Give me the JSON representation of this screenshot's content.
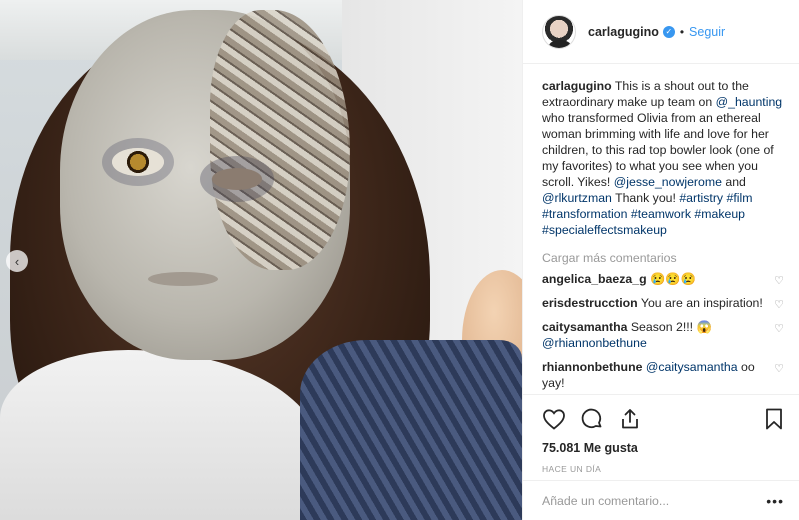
{
  "post": {
    "username": "carlagugino",
    "follow_label": "Seguir",
    "dot": "•",
    "caption": {
      "username": "carlagugino",
      "text_1": " This is a shout out to the extraordinary make up team on ",
      "mention_1": "@_haunting",
      "text_2": " who transformed Olivia from an ethereal woman brimming with life and love for her children, to this rad top bowler look (one of my favorites) to what you see when you scroll. Yikes! ",
      "mention_2": "@jesse_nowjerome",
      "text_3": " and ",
      "mention_3": "@rlkurtzman",
      "text_4": " Thank you! ",
      "hashtags": "#artistry #film #transformation #teamwork #makeup #specialeffectsmakeup"
    },
    "load_more_label": "Cargar más comentarios",
    "comments": [
      {
        "username": "angelica_baeza_g",
        "text": "😢😢😢",
        "mention": ""
      },
      {
        "username": "erisdestrucction",
        "text": "You are an inspiration!",
        "mention": ""
      },
      {
        "username": "caitysamantha",
        "text": "Season 2!!! 😱 ",
        "mention": "@rhiannonbethune"
      },
      {
        "username": "rhiannonbethune",
        "text": " oo yay!",
        "mention": "@caitysamantha",
        "mention_first": true
      }
    ],
    "likes": "75.081 Me gusta",
    "time": "HACE UN DÍA",
    "add_comment_placeholder": "Añade un comentario...",
    "more_options": "•••"
  },
  "photo": {
    "carousel_arrow": "‹"
  },
  "colors": {
    "link_blue": "#3897f0",
    "mention_blue": "#003569",
    "muted": "#999999"
  },
  "icons": [
    "verified-badge-icon",
    "heart-icon",
    "comment-icon",
    "share-icon",
    "bookmark-icon",
    "chevron-left-icon"
  ]
}
